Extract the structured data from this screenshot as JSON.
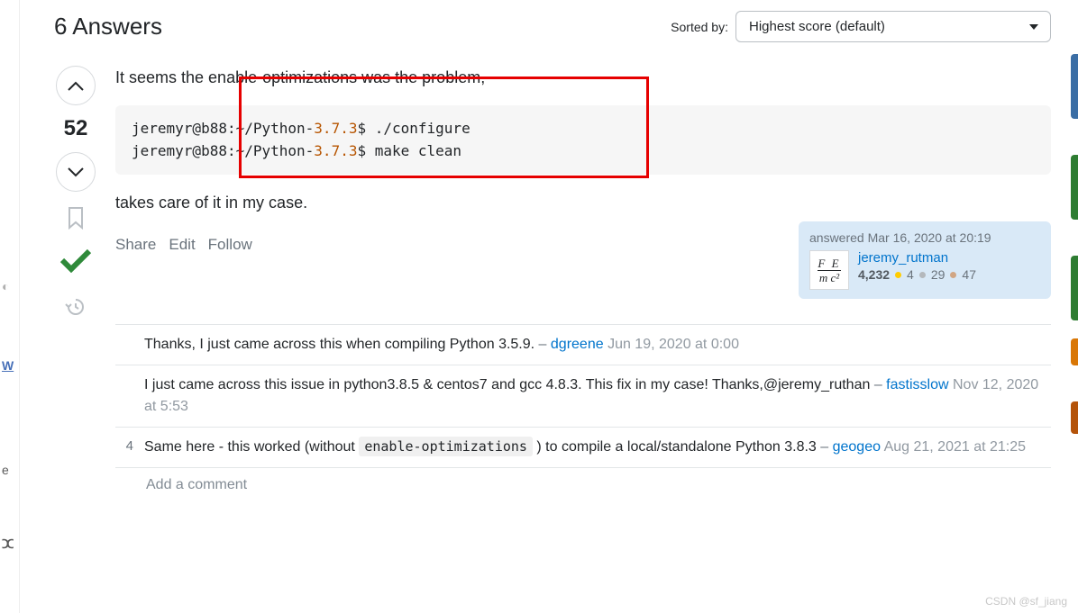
{
  "header": {
    "title": "6 Answers",
    "sortLabel": "Sorted by:",
    "sortValue": "Highest score (default)"
  },
  "vote": {
    "score": "52"
  },
  "prose": {
    "p1": "It seems the enable-optimizations was the problem,",
    "p2": "takes care of it in my case."
  },
  "code": {
    "l1a": "jeremyr@b88:~/Python-",
    "l1ver": "3.7.3",
    "l1b": "$ ./configure",
    "l2a": "jeremyr@b88:~/Python-",
    "l2ver": "3.7.3",
    "l2b": "$ make clean"
  },
  "actions": {
    "share": "Share",
    "edit": "Edit",
    "follow": "Follow"
  },
  "usercard": {
    "answered": "answered Mar 16, 2020 at 20:19",
    "avatarTop": "F E",
    "avatarBot": "m c²",
    "name": "jeremy_rutman",
    "rep": "4,232",
    "gold": "4",
    "silver": "29",
    "bronze": "47"
  },
  "comments": [
    {
      "score": "",
      "preText": "Thanks, I just came across this when compiling Python 3.5.9.",
      "postText": "",
      "user": "dgreene",
      "date": "Jun 19, 2020 at 0:00",
      "code": ""
    },
    {
      "score": "",
      "preText": "I just came across this issue in python3.8.5 & centos7 and gcc 4.8.3. This fix in my case! Thanks,@jeremy_ruthan",
      "postText": "",
      "user": "fastisslow",
      "date": "Nov 12, 2020 at 5:53",
      "code": ""
    },
    {
      "score": "4",
      "preText": "Same here - this worked (without ",
      "code": "enable-optimizations",
      "postText": " ) to compile a local/standalone Python 3.8.3",
      "user": "geogeo",
      "date": "Aug 21, 2021 at 21:25"
    }
  ],
  "addComment": "Add a comment",
  "watermark": "CSDN @sf_jiang"
}
